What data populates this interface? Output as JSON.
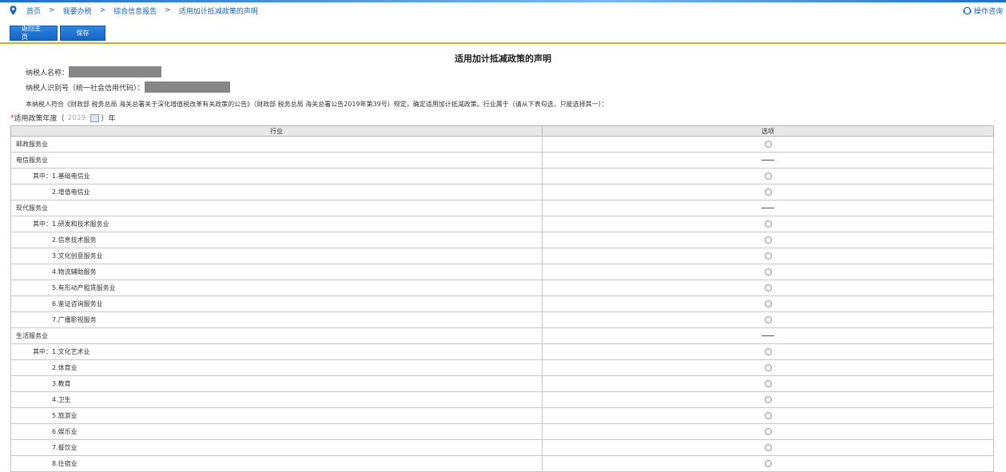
{
  "breadcrumb": [
    "首页",
    "我要办税",
    "综合信息报告",
    "适用加计抵减政策的声明"
  ],
  "breadcrumb_sep": ">",
  "help_label": "操作咨询",
  "buttons": {
    "back": "返回主页",
    "save": "保存"
  },
  "title": "适用加计抵减政策的声明",
  "taxpayer_name_label": "纳税人名称：",
  "taxpayer_id_label": "纳税人识别号（统一社会信用代码）：",
  "declaration": "本纳税人符合《财政部 税务总局 海关总署关于深化增值税改革有关政策的公告》（财政部 税务总局 海关总署公告2019年第39号）规定，确定适用加计抵减政策。行业属于（请从下表勾选，只能选择其一）：",
  "year": {
    "required_mark": "*",
    "label": "适用政策年度（",
    "value": "2019",
    "suffix": "）年"
  },
  "table": {
    "headers": [
      "行业",
      "选项"
    ],
    "rows": [
      {
        "label": "邮政服务业",
        "level": 0,
        "option": "radio"
      },
      {
        "label": "电信服务业",
        "level": 0,
        "option": "dash"
      },
      {
        "label": "其中：1.基础电信业",
        "level": 1,
        "option": "radio"
      },
      {
        "label": "2.增值电信业",
        "level": 2,
        "option": "radio"
      },
      {
        "label": "现代服务业",
        "level": 0,
        "option": "dash"
      },
      {
        "label": "其中：1.研发和技术服务业",
        "level": 1,
        "option": "radio"
      },
      {
        "label": "2.信息技术服务",
        "level": 2,
        "option": "radio"
      },
      {
        "label": "3.文化创意服务业",
        "level": 2,
        "option": "radio"
      },
      {
        "label": "4.物流辅助服务",
        "level": 2,
        "option": "radio"
      },
      {
        "label": "5.有形动产租赁服务业",
        "level": 2,
        "option": "radio"
      },
      {
        "label": "6.鉴证咨询服务业",
        "level": 2,
        "option": "radio"
      },
      {
        "label": "7.广播影视服务",
        "level": 2,
        "option": "radio"
      },
      {
        "label": "生活服务业",
        "level": 0,
        "option": "dash"
      },
      {
        "label": "其中：1.文化艺术业",
        "level": 1,
        "option": "radio"
      },
      {
        "label": "2.体育业",
        "level": 2,
        "option": "radio"
      },
      {
        "label": "3.教育",
        "level": 2,
        "option": "radio"
      },
      {
        "label": "4.卫生",
        "level": 2,
        "option": "radio"
      },
      {
        "label": "5.旅游业",
        "level": 2,
        "option": "radio"
      },
      {
        "label": "6.娱乐业",
        "level": 2,
        "option": "radio"
      },
      {
        "label": "7.餐饮业",
        "level": 2,
        "option": "radio"
      },
      {
        "label": "8.住宿业",
        "level": 2,
        "option": "radio"
      }
    ]
  }
}
